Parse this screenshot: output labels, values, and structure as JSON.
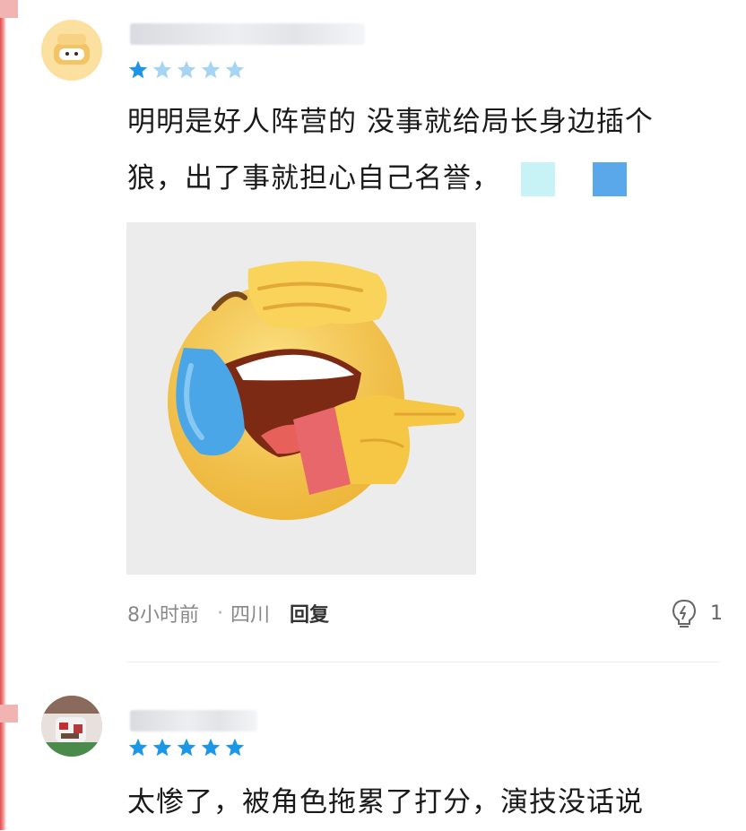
{
  "comments": [
    {
      "username": "",
      "rating": 1,
      "rating_max": 5,
      "text_lines": [
        "明明是好人阵营的 没事就给局长身边插个",
        "狼，出了事就担心自己名誉，"
      ],
      "inline_emojis": [
        "light-cyan-emoji",
        "blue-emoji"
      ],
      "image": "laughing-crying-facepalm-pointing-emoji",
      "time": "8小时前",
      "separator": "·",
      "region": "四川",
      "reply_label": "回复",
      "like_icon": "lightbulb-icon",
      "likes": "1"
    },
    {
      "username": "",
      "rating": 5,
      "rating_max": 5,
      "text_lines": [
        "太惨了，被角色拖累了打分，演技没话说"
      ]
    }
  ],
  "colors": {
    "star_active": "#1e96e6",
    "star_inactive": "#a7d4f2",
    "edge": "#e24a4a"
  }
}
